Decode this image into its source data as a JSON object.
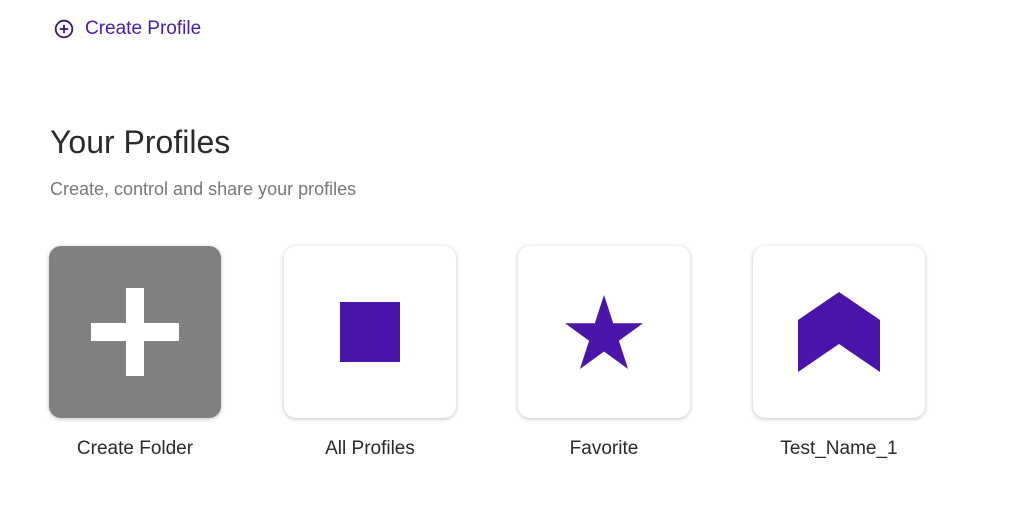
{
  "header": {
    "create_profile_label": "Create Profile"
  },
  "section": {
    "title": "Your Profiles",
    "subtitle": "Create, control and share your profiles"
  },
  "tiles": [
    {
      "label": "Create Folder",
      "icon": "plus-icon"
    },
    {
      "label": "All Profiles",
      "icon": "square-icon"
    },
    {
      "label": "Favorite",
      "icon": "star-icon"
    },
    {
      "label": "Test_Name_1",
      "icon": "chevron-up-icon"
    }
  ],
  "colors": {
    "accent": "#4a14aa",
    "folder_tile_bg": "#808080",
    "title_text": "#2a2a2a",
    "subtitle_text": "#777777"
  }
}
